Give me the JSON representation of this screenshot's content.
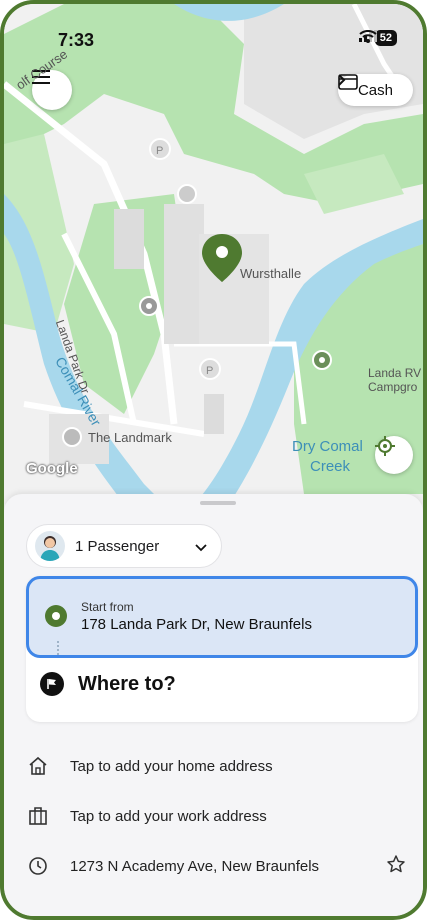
{
  "status": {
    "time": "7:33",
    "battery": "52"
  },
  "map": {
    "cash_label": "Cash",
    "place_wursthalle": "Wursthalle",
    "road_landa_park_dr": "Landa Park Dr",
    "river_comal": "Comal River",
    "place_landmark": "The Landmark",
    "water_dry_comal_1": "Dry Comal",
    "water_dry_comal_2": "Creek",
    "place_landa_rv_1": "Landa RV",
    "place_landa_rv_2": "Campgro",
    "road_golf_course": "olf Course",
    "google": "Google"
  },
  "passengers": {
    "label": "1 Passenger"
  },
  "route": {
    "start_label": "Start from",
    "start_address": "178 Landa Park Dr, New Braunfels",
    "where_to": "Where to?"
  },
  "shortcuts": {
    "home": "Tap to add your home address",
    "work": "Tap to add your work address",
    "recent": "1273 N Academy Ave, New Braunfels"
  },
  "colors": {
    "brand_green": "#4f7a30",
    "highlight_blue": "#3f86e8",
    "water": "#a8d8ec",
    "park": "#b6e3b0"
  }
}
